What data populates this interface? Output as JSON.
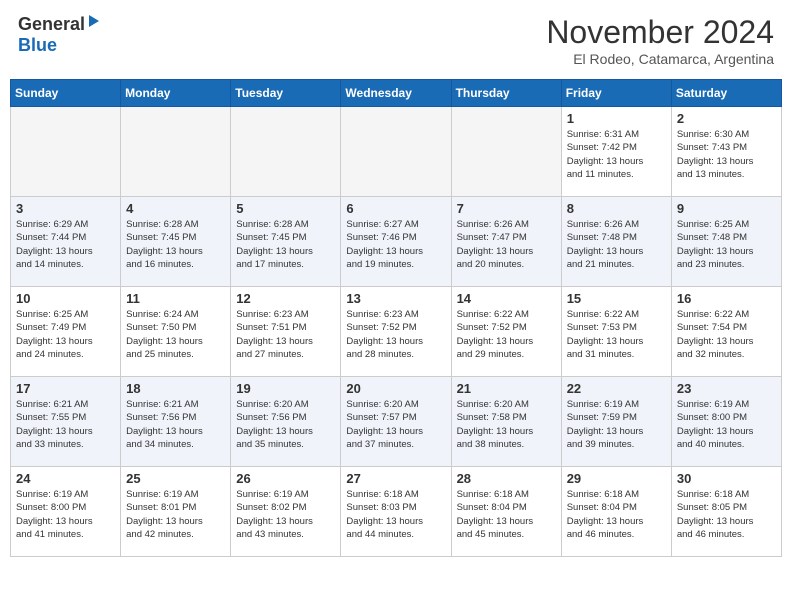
{
  "header": {
    "logo_general": "General",
    "logo_blue": "Blue",
    "month": "November 2024",
    "location": "El Rodeo, Catamarca, Argentina"
  },
  "days_of_week": [
    "Sunday",
    "Monday",
    "Tuesday",
    "Wednesday",
    "Thursday",
    "Friday",
    "Saturday"
  ],
  "weeks": [
    [
      {
        "day": "",
        "info": ""
      },
      {
        "day": "",
        "info": ""
      },
      {
        "day": "",
        "info": ""
      },
      {
        "day": "",
        "info": ""
      },
      {
        "day": "",
        "info": ""
      },
      {
        "day": "1",
        "info": "Sunrise: 6:31 AM\nSunset: 7:42 PM\nDaylight: 13 hours\nand 11 minutes."
      },
      {
        "day": "2",
        "info": "Sunrise: 6:30 AM\nSunset: 7:43 PM\nDaylight: 13 hours\nand 13 minutes."
      }
    ],
    [
      {
        "day": "3",
        "info": "Sunrise: 6:29 AM\nSunset: 7:44 PM\nDaylight: 13 hours\nand 14 minutes."
      },
      {
        "day": "4",
        "info": "Sunrise: 6:28 AM\nSunset: 7:45 PM\nDaylight: 13 hours\nand 16 minutes."
      },
      {
        "day": "5",
        "info": "Sunrise: 6:28 AM\nSunset: 7:45 PM\nDaylight: 13 hours\nand 17 minutes."
      },
      {
        "day": "6",
        "info": "Sunrise: 6:27 AM\nSunset: 7:46 PM\nDaylight: 13 hours\nand 19 minutes."
      },
      {
        "day": "7",
        "info": "Sunrise: 6:26 AM\nSunset: 7:47 PM\nDaylight: 13 hours\nand 20 minutes."
      },
      {
        "day": "8",
        "info": "Sunrise: 6:26 AM\nSunset: 7:48 PM\nDaylight: 13 hours\nand 21 minutes."
      },
      {
        "day": "9",
        "info": "Sunrise: 6:25 AM\nSunset: 7:48 PM\nDaylight: 13 hours\nand 23 minutes."
      }
    ],
    [
      {
        "day": "10",
        "info": "Sunrise: 6:25 AM\nSunset: 7:49 PM\nDaylight: 13 hours\nand 24 minutes."
      },
      {
        "day": "11",
        "info": "Sunrise: 6:24 AM\nSunset: 7:50 PM\nDaylight: 13 hours\nand 25 minutes."
      },
      {
        "day": "12",
        "info": "Sunrise: 6:23 AM\nSunset: 7:51 PM\nDaylight: 13 hours\nand 27 minutes."
      },
      {
        "day": "13",
        "info": "Sunrise: 6:23 AM\nSunset: 7:52 PM\nDaylight: 13 hours\nand 28 minutes."
      },
      {
        "day": "14",
        "info": "Sunrise: 6:22 AM\nSunset: 7:52 PM\nDaylight: 13 hours\nand 29 minutes."
      },
      {
        "day": "15",
        "info": "Sunrise: 6:22 AM\nSunset: 7:53 PM\nDaylight: 13 hours\nand 31 minutes."
      },
      {
        "day": "16",
        "info": "Sunrise: 6:22 AM\nSunset: 7:54 PM\nDaylight: 13 hours\nand 32 minutes."
      }
    ],
    [
      {
        "day": "17",
        "info": "Sunrise: 6:21 AM\nSunset: 7:55 PM\nDaylight: 13 hours\nand 33 minutes."
      },
      {
        "day": "18",
        "info": "Sunrise: 6:21 AM\nSunset: 7:56 PM\nDaylight: 13 hours\nand 34 minutes."
      },
      {
        "day": "19",
        "info": "Sunrise: 6:20 AM\nSunset: 7:56 PM\nDaylight: 13 hours\nand 35 minutes."
      },
      {
        "day": "20",
        "info": "Sunrise: 6:20 AM\nSunset: 7:57 PM\nDaylight: 13 hours\nand 37 minutes."
      },
      {
        "day": "21",
        "info": "Sunrise: 6:20 AM\nSunset: 7:58 PM\nDaylight: 13 hours\nand 38 minutes."
      },
      {
        "day": "22",
        "info": "Sunrise: 6:19 AM\nSunset: 7:59 PM\nDaylight: 13 hours\nand 39 minutes."
      },
      {
        "day": "23",
        "info": "Sunrise: 6:19 AM\nSunset: 8:00 PM\nDaylight: 13 hours\nand 40 minutes."
      }
    ],
    [
      {
        "day": "24",
        "info": "Sunrise: 6:19 AM\nSunset: 8:00 PM\nDaylight: 13 hours\nand 41 minutes."
      },
      {
        "day": "25",
        "info": "Sunrise: 6:19 AM\nSunset: 8:01 PM\nDaylight: 13 hours\nand 42 minutes."
      },
      {
        "day": "26",
        "info": "Sunrise: 6:19 AM\nSunset: 8:02 PM\nDaylight: 13 hours\nand 43 minutes."
      },
      {
        "day": "27",
        "info": "Sunrise: 6:18 AM\nSunset: 8:03 PM\nDaylight: 13 hours\nand 44 minutes."
      },
      {
        "day": "28",
        "info": "Sunrise: 6:18 AM\nSunset: 8:04 PM\nDaylight: 13 hours\nand 45 minutes."
      },
      {
        "day": "29",
        "info": "Sunrise: 6:18 AM\nSunset: 8:04 PM\nDaylight: 13 hours\nand 46 minutes."
      },
      {
        "day": "30",
        "info": "Sunrise: 6:18 AM\nSunset: 8:05 PM\nDaylight: 13 hours\nand 46 minutes."
      }
    ]
  ]
}
